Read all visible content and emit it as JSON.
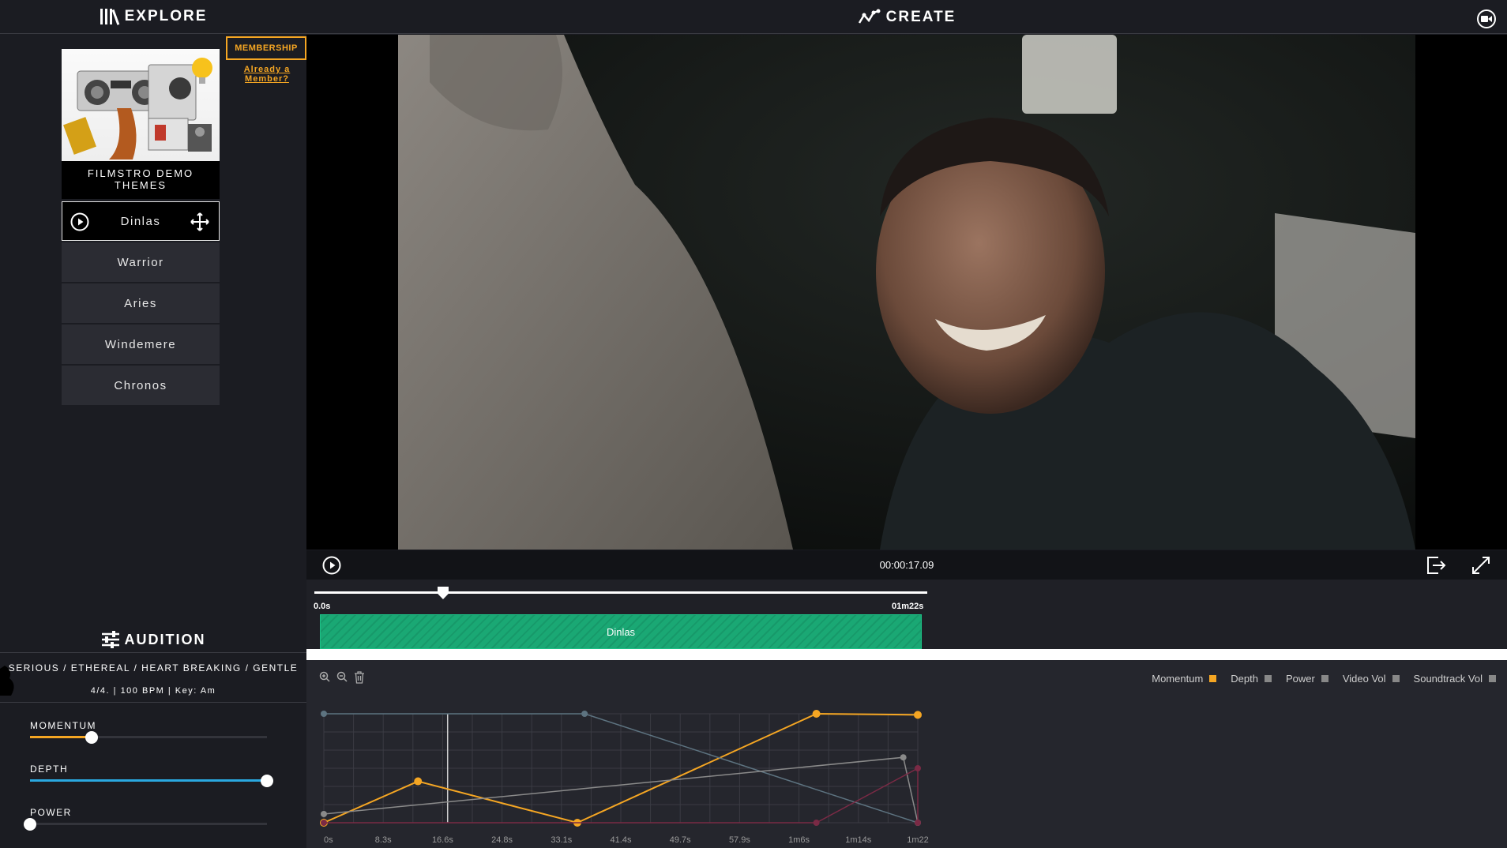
{
  "sidebar": {
    "title": "EXPLORE",
    "membership": "MEMBERSHIP",
    "already_member": "Already a Member?",
    "theme_title": "FILMSTRO DEMO THEMES",
    "tracks": [
      "Dinlas",
      "Warrior",
      "Aries",
      "Windemere",
      "Chronos"
    ],
    "active_track": "Dinlas"
  },
  "audition": {
    "title": "AUDITION",
    "tags": "SERIOUS / ETHEREAL / HEART BREAKING / GENTLE",
    "meta": "4/4. | 100 BPM | Key: Am",
    "sliders": [
      {
        "label": "MOMENTUM",
        "value": 0.26,
        "color": "#f5a623"
      },
      {
        "label": "DEPTH",
        "value": 1.0,
        "color": "#2aa8e0"
      },
      {
        "label": "POWER",
        "value": 0.0,
        "color": "#555555"
      }
    ]
  },
  "create": {
    "title": "CREATE",
    "timecode": "00:00:17.09"
  },
  "timeline": {
    "start_label": "0.0s",
    "end_label": "01m22s",
    "playhead": 0.21,
    "clip_label": "Dinlas"
  },
  "graph": {
    "legend": [
      {
        "name": "Momentum",
        "color": "#f5a623"
      },
      {
        "name": "Depth",
        "color": "#888888"
      },
      {
        "name": "Power",
        "color": "#888888"
      },
      {
        "name": "Video Vol",
        "color": "#888888"
      },
      {
        "name": "Soundtrack Vol",
        "color": "#888888"
      }
    ]
  },
  "chart_data": {
    "type": "line",
    "x_ticks": [
      "0s",
      "8.3s",
      "16.6s",
      "24.8s",
      "33.1s",
      "41.4s",
      "49.7s",
      "57.9s",
      "1m6s",
      "1m14s",
      "1m22"
    ],
    "xlim": [
      0,
      82
    ],
    "ylim": [
      0,
      1
    ],
    "playhead": 17.09,
    "grid": true,
    "series": [
      {
        "name": "Momentum",
        "color": "#f5a623",
        "points": [
          [
            0,
            0
          ],
          [
            13,
            0.38
          ],
          [
            35,
            0
          ],
          [
            68,
            1.0
          ],
          [
            82,
            0.99
          ]
        ]
      },
      {
        "name": "Depth",
        "color": "#5d7380",
        "points": [
          [
            0,
            1.0
          ],
          [
            36,
            1.0
          ],
          [
            82,
            0
          ]
        ]
      },
      {
        "name": "Power",
        "color": "#8a8a8a",
        "points": [
          [
            0,
            0.08
          ],
          [
            80,
            0.6
          ],
          [
            82,
            0
          ]
        ]
      },
      {
        "name": "Soundtrack Vol",
        "color": "#7a2a45",
        "points": [
          [
            0,
            0
          ],
          [
            68,
            0
          ],
          [
            82,
            0.5
          ],
          [
            82,
            0
          ]
        ]
      }
    ]
  }
}
